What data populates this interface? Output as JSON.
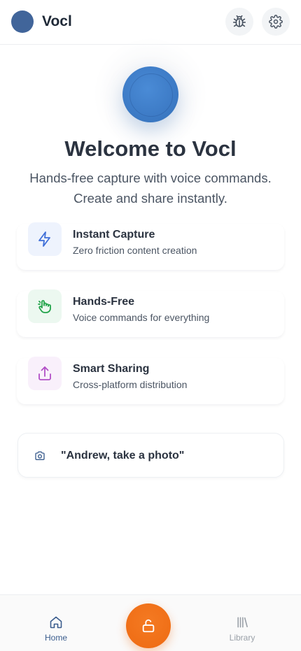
{
  "header": {
    "app_name": "Vocl",
    "bug_icon": "bug-icon",
    "settings_icon": "gear-icon"
  },
  "hero": {
    "title": "Welcome to Vocl",
    "subtitle": "Hands-free capture with voice commands. Create and share instantly."
  },
  "features": [
    {
      "title": "Instant Capture",
      "description": "Zero friction content creation",
      "icon": "lightning-icon",
      "color": "#3f6fd8"
    },
    {
      "title": "Hands-Free",
      "description": "Voice commands for everything",
      "icon": "hand-gesture-icon",
      "color": "#22a34a"
    },
    {
      "title": "Smart Sharing",
      "description": "Cross-platform distribution",
      "icon": "share-upload-icon",
      "color": "#b24fc7"
    }
  ],
  "command_example": {
    "text": "\"Andrew, take a photo\"",
    "icon": "camera-icon"
  },
  "bottom_nav": {
    "home_label": "Home",
    "library_label": "Library",
    "center_icon": "unlock-icon",
    "accent": "#ee6a12"
  }
}
